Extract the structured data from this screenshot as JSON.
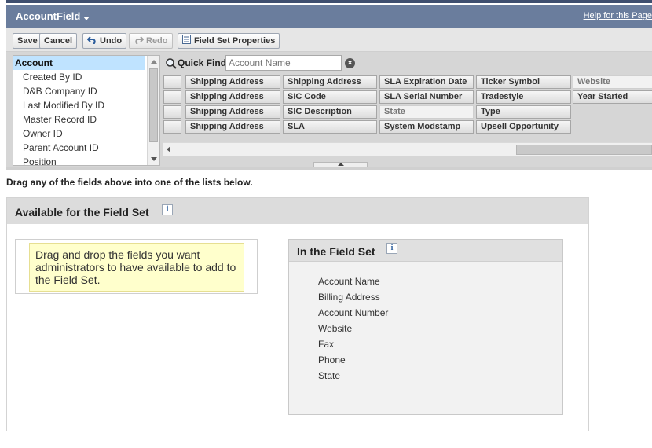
{
  "header": {
    "title": "AccountField",
    "help_link": "Help for this Page"
  },
  "toolbar": {
    "save_label": "Save",
    "cancel_label": "Cancel",
    "undo_label": "Undo",
    "redo_label": "Redo",
    "field_set_properties_label": "Field Set Properties"
  },
  "object_list": {
    "items": [
      "Account",
      "Created By ID",
      "D&B Company ID",
      "Last Modified By ID",
      "Master Record ID",
      "Owner ID",
      "Parent Account ID",
      "Position"
    ],
    "selected_index": 0
  },
  "quick_find": {
    "label": "Quick Find",
    "placeholder": "Account Name"
  },
  "field_grid": {
    "columns": [
      [
        "",
        "",
        "",
        ""
      ],
      [
        "Shipping Address",
        "Shipping Address",
        "Shipping Address",
        "Shipping Address"
      ],
      [
        "Shipping Address",
        "SIC Code",
        "SIC Description",
        "SLA"
      ],
      [
        "SLA Expiration Date",
        "SLA Serial Number",
        "State",
        "System Modstamp"
      ],
      [
        "Ticker Symbol",
        "Tradestyle",
        "Type",
        "Upsell Opportunity"
      ],
      [
        "Website",
        "Year Started"
      ]
    ],
    "used_fields": [
      "State",
      "Website"
    ]
  },
  "instructions": "Drag any of the fields above into one of the lists below.",
  "available": {
    "title": "Available for the Field Set",
    "info_glyph": "i",
    "hint": "Drag and drop the fields you want administrators to have available to add to the Field Set."
  },
  "in_field_set": {
    "title": "In the Field Set",
    "info_glyph": "i",
    "items": [
      "Account Name",
      "Billing Address",
      "Account Number",
      "Website",
      "Fax",
      "Phone",
      "State"
    ]
  },
  "icons": {
    "title_caret": "chevron-down-icon",
    "undo": "undo-icon",
    "redo": "redo-icon",
    "properties": "properties-icon",
    "search": "search-icon",
    "clear": "clear-icon",
    "info": "info-icon"
  },
  "colors": {
    "title_bar": "#6a7d9d",
    "selected_item": "#bfe3ff",
    "hint_background": "#ffffcc",
    "panel_header": "#dcdcdc"
  }
}
